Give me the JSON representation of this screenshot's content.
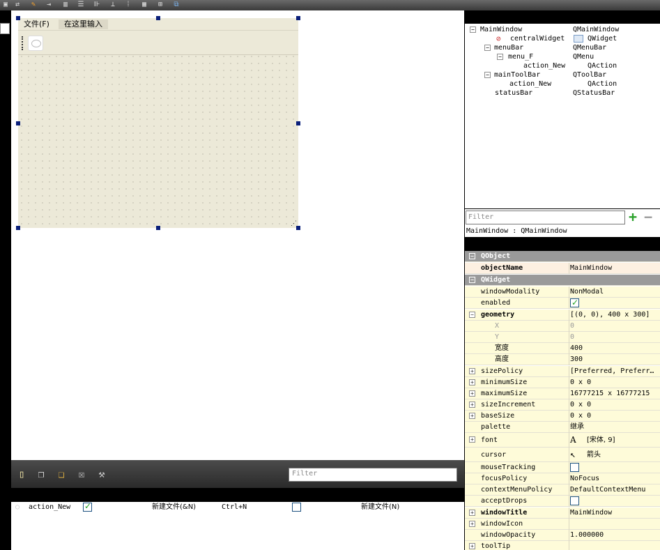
{
  "top_toolbar": {
    "icons": [
      "edit-widgets-icon",
      "edit-signals-icon",
      "edit-buddies-icon",
      "edit-tab-order-icon",
      "layout-horizontal-icon",
      "layout-vertical-icon",
      "layout-h-splitter-icon",
      "layout-v-splitter-icon",
      "layout-form-icon",
      "layout-grid-icon",
      "break-layout-icon",
      "adjust-size-icon"
    ]
  },
  "form": {
    "menu_file": "文件(F)",
    "menu_type_here": "在这里输入"
  },
  "object_inspector": {
    "rows": [
      {
        "name": "MainWindow",
        "class": "QMainWindow"
      },
      {
        "name": "centralWidget",
        "class": "QWidget"
      },
      {
        "name": "menuBar",
        "class": "QMenuBar"
      },
      {
        "name": "menu_F",
        "class": "QMenu"
      },
      {
        "name": "action_New",
        "class": "QAction"
      },
      {
        "name": "mainToolBar",
        "class": "QToolBar"
      },
      {
        "name": "action_New",
        "class": "QAction"
      },
      {
        "name": "statusBar",
        "class": "QStatusBar"
      }
    ],
    "filter_placeholder": "Filter",
    "caption": "MainWindow : QMainWindow"
  },
  "property_editor": {
    "rows": [
      {
        "name": "QObject",
        "value": ""
      },
      {
        "name": "objectName",
        "value": "MainWindow"
      },
      {
        "name": "QWidget",
        "value": ""
      },
      {
        "name": "windowModality",
        "value": "NonModal"
      },
      {
        "name": "enabled",
        "value": ""
      },
      {
        "name": "geometry",
        "value": "[(0, 0), 400 x 300]"
      },
      {
        "name": "X",
        "value": "0"
      },
      {
        "name": "Y",
        "value": "0"
      },
      {
        "name": "宽度",
        "value": "400"
      },
      {
        "name": "高度",
        "value": "300"
      },
      {
        "name": "sizePolicy",
        "value": "[Preferred, Preferr…"
      },
      {
        "name": "minimumSize",
        "value": "0 x 0"
      },
      {
        "name": "maximumSize",
        "value": "16777215 x 16777215"
      },
      {
        "name": "sizeIncrement",
        "value": "0 x 0"
      },
      {
        "name": "baseSize",
        "value": "0 x 0"
      },
      {
        "name": "palette",
        "value": "继承"
      },
      {
        "name": "font",
        "value": "[宋体, 9]"
      },
      {
        "name": "cursor",
        "value": "箭头"
      },
      {
        "name": "mouseTracking",
        "value": ""
      },
      {
        "name": "focusPolicy",
        "value": "NoFocus"
      },
      {
        "name": "contextMenuPolicy",
        "value": "DefaultContextMenu"
      },
      {
        "name": "acceptDrops",
        "value": ""
      },
      {
        "name": "windowTitle",
        "value": "MainWindow"
      },
      {
        "name": "windowIcon",
        "value": ""
      },
      {
        "name": "windowOpacity",
        "value": "1.000000"
      },
      {
        "name": "toolTip",
        "value": ""
      }
    ],
    "font_glyph": "A"
  },
  "action_editor": {
    "filter_placeholder": "Filter",
    "row": {
      "name": "action_New",
      "used": true,
      "text": "新建文件(&N)",
      "shortcut": "Ctrl+N",
      "checkable": false,
      "tooltip": "新建文件(N)"
    }
  }
}
